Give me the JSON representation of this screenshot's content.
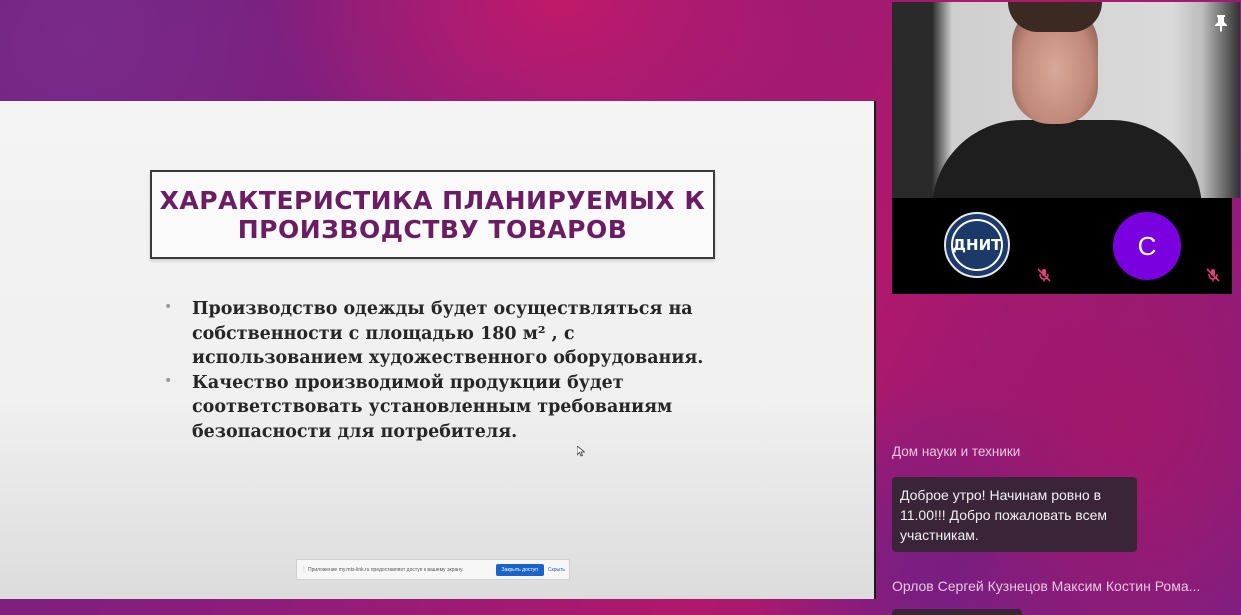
{
  "slide": {
    "title_line1": "ХАРАКТЕРИСТИКА ПЛАНИРУЕМЫХ К",
    "title_line2": "ПРОИЗВОДСТВУ ТОВАРОВ",
    "bullets": [
      {
        "line1": "Производство одежды будет осуществляться на",
        "line2": "собственности с площадью 180 м² , с",
        "line3": "использованием художественного оборудования."
      },
      {
        "line1": "Качество производимой продукции будет",
        "line2": "соответствовать установленным требованиям",
        "line3": "безопасности для потребителя."
      }
    ],
    "bullet_symbol": "•"
  },
  "share_bar": {
    "message": "Приложение my.mts-link.ru предоставляет доступ к вашему экрану.",
    "stop_label": "Закрыть доступ",
    "hide_label": "Скрыть"
  },
  "participants_panel": {
    "avatar_dnit_text": "ДНИТ",
    "avatar_c_letter": "С"
  },
  "chat": {
    "sender": "Дом науки и техники",
    "message_line1": "Доброе утро! Начинам ровно в",
    "message_line2": "11.00!!! Добро пожаловать всем",
    "message_line3": "участникам.",
    "next_sender": "Орлов Сергей Кузнецов Максим Костин Рома..."
  },
  "colors": {
    "title": "#6a1d63",
    "avatar_c": "#7a00e0",
    "avatar_dnit": "#1b3a6a",
    "share_button": "#1a63c9",
    "mic_off": "#e0407a"
  },
  "icons": [
    "pin-icon",
    "mic-off-icon",
    "cursor-icon"
  ]
}
